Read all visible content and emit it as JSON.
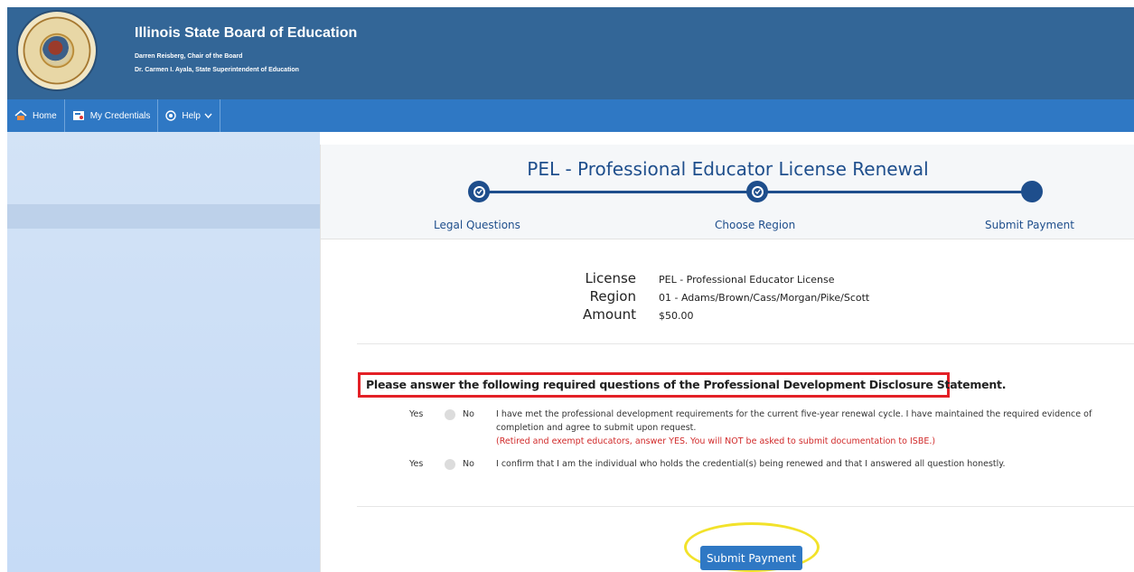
{
  "header": {
    "title": "Illinois State Board of Education",
    "chair": "Darren Reisberg, Chair of the Board",
    "superintendent": "Dr. Carmen I. Ayala, State Superintendent of Education"
  },
  "nav": {
    "home": "Home",
    "credentials": "My Credentials",
    "help": "Help"
  },
  "page": {
    "title": "PEL - Professional Educator License Renewal",
    "steps": [
      "Legal Questions",
      "Choose Region",
      "Submit Payment"
    ]
  },
  "details": {
    "license_label": "License",
    "license_value": "PEL - Professional Educator License",
    "region_label": "Region",
    "region_value": "01 - Adams/Brown/Cass/Morgan/Pike/Scott",
    "amount_label": "Amount",
    "amount_value": "$50.00"
  },
  "questions": {
    "heading": "Please answer the following required questions of the Professional Development Disclosure Statement.",
    "yes_label": "Yes",
    "no_label": "No",
    "q1_line1": "I have met the professional development requirements for the current five-year renewal cycle. I have maintained the required evidence of",
    "q1_line2": "completion and agree to submit upon request.",
    "q1_note": "(Retired and exempt educators, answer YES. You will NOT be asked to submit documentation to ISBE.)",
    "q2": "I confirm that I am the individual who holds the credential(s) being renewed and that I answered all question honestly."
  },
  "actions": {
    "submit_label": "Submit Payment"
  },
  "colors": {
    "header_bg": "#336697",
    "nav_bg": "#2f78c4",
    "brand_blue": "#1e4e8c",
    "highlight_red": "#e32026",
    "highlight_yellow": "#f2e22a"
  },
  "icons": {
    "home": "home-icon",
    "credentials": "credentials-icon",
    "help": "help-icon",
    "step_done": "check-icon"
  }
}
